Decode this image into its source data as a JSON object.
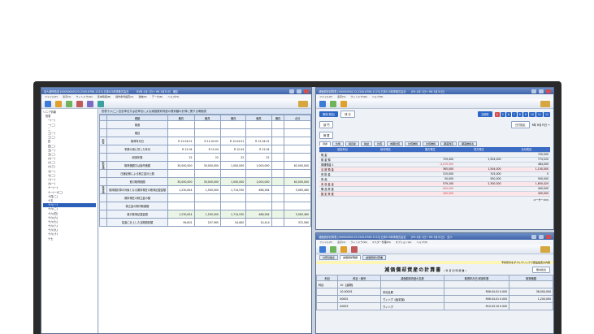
{
  "left_window": {
    "title": "法人税申告書 [00000000123-2345-6789-1123] 日本ICS商事株式会社　　　R5年 4月 1日～ R6 3月31日　確定",
    "menu": [
      "ファイル(F)",
      "表示(V)",
      "ウィンドウ(W)",
      "基本情報(B)",
      "操作条件設定(S)",
      "送信(E)",
      "データ(D)",
      "ヘルプ(H)"
    ],
    "tree": [
      "リニア情報",
      "別表",
      "一(一)",
      "一(二)",
      "二",
      "三(一)",
      "三(二)",
      "四",
      "四(二)",
      "五(一)",
      "五(二)",
      "六(一)",
      "六(二)",
      "六(三)",
      "七(一)",
      "七(二)",
      "八(一)",
      "九(一)",
      "十一(一)",
      "十一(一の二)",
      "十四(二)",
      "十五",
      "十六(一)",
      "十六(二)",
      "十六(四)",
      "十六(六)",
      "十六(七)",
      "十六(八)",
      "十六(九)",
      "十六(十)",
      "十七"
    ],
    "tree_selected_index": 22,
    "form_title": "別表十六(二) 旧定率法又は定率法による減価償却資産の償却額の計算に関する明細書",
    "header_row": [
      "種類",
      "器具",
      "器具",
      "器具",
      "器具",
      "器具",
      "合計"
    ],
    "rows": [
      {
        "side": "",
        "label": "構造",
        "values": [
          "",
          "",
          "",
          "",
          "",
          ""
        ]
      },
      {
        "side": "",
        "label": "細目",
        "values": [
          "",
          "",
          "",
          "",
          "",
          ""
        ]
      },
      {
        "side": "取得",
        "label": "取得年月日",
        "values": [
          "R 12.04.01",
          "R 12.04.01",
          "R 12.04.01",
          "R 12.04.01",
          "",
          ""
        ]
      },
      {
        "side": "",
        "label": "事業の用に供した年月",
        "values": [
          "R 12.04",
          "R 12.04",
          "R 12.04",
          "R 12.04",
          "",
          ""
        ]
      },
      {
        "side": "",
        "label": "耐用年数",
        "values": [
          "22",
          "22",
          "22",
          "22",
          "",
          ""
        ]
      },
      {
        "side": "取得価額",
        "label": "取得価額又は製作価額",
        "values": [
          "30,000,000",
          "30,000,000",
          "1,000,000",
          "1,000,000",
          "",
          "62,000,000"
        ]
      },
      {
        "side": "",
        "label": "圧縮記帳による積立金計上額",
        "values": [
          "",
          "",
          "",
          "",
          "",
          ""
        ]
      },
      {
        "side": "",
        "label": "差引取得価額",
        "values": [
          "30,000,000",
          "30,000,000",
          "1,000,000",
          "1,000,000",
          "",
          "62,000,000"
        ]
      },
      {
        "side": "帳簿価額",
        "label": "償却額計算の対象となる期末現在の帳簿記載金額",
        "values": [
          "1,230,624",
          "1,500,000",
          "1,714,530",
          "468,264",
          "",
          "5,063,460"
        ]
      },
      {
        "side": "",
        "label": "期末現在の積立金の額",
        "values": [
          "",
          "",
          "",
          "",
          "",
          ""
        ]
      },
      {
        "side": "",
        "label": "積立金の期中取崩額",
        "values": [
          "",
          "",
          "",
          "",
          "",
          ""
        ]
      },
      {
        "side": "",
        "label": "差引帳簿記載金額",
        "values": [
          "1,230,624",
          "1,500,000",
          "1,714,530",
          "468,264",
          "",
          "5,063,460"
        ]
      },
      {
        "side": "",
        "label": "損金に計上した当期償却額",
        "values": [
          "99,801",
          "207,565",
          "54,600",
          "10,414",
          "",
          "372,560"
        ]
      }
    ]
  },
  "right_top_window": {
    "title": "減価償却試算表 [00000000123-2345-6789-1123] 日本ICS商事株式会社　　(R5 4月 1日～ R6 3月31日)",
    "menu": [
      "ファイル(F)",
      "表示(V)",
      "ウィンドウ(W)",
      "ヘルプ(H)"
    ],
    "fields": [
      "期首(残高)",
      "残 日",
      "部 門",
      "摘 要"
    ],
    "period_label": "当期末",
    "period_tabs": [
      "4",
      "5",
      "6",
      "7",
      "8",
      "9",
      "10",
      "11",
      "12"
    ],
    "date_label": "日付指定",
    "date_value": "R年 R月 R日 ～",
    "tabs": [
      "資産",
      "負債",
      "純資産",
      "損益",
      "比較",
      "前期比較",
      "比較推移",
      "比較推移",
      "期首残高",
      "期首推移表"
    ],
    "columns": [
      "勘定科目",
      "前月残高",
      "借方発生",
      "貸方発生",
      "当月残高"
    ],
    "rows": [
      {
        "name": "現 金",
        "v": [
          "",
          "",
          "",
          "750,000"
        ],
        "pink": false
      },
      {
        "name": "現 金 預",
        "v": [
          "",
          "729,400",
          "1,504,000",
          "774,520"
        ],
        "pink": false
      },
      {
        "name": "普通預金 1",
        "v": [
          "",
          "-4,019,300",
          "",
          "484,000"
        ],
        "pink": false,
        "red": 1
      },
      {
        "name": "当 座 預 金",
        "v": [
          "",
          "365,000",
          "1,504,000",
          "1,100,000"
        ],
        "pink": true
      },
      {
        "name": "売 掛 金",
        "v": [
          "",
          "315,000",
          "315,000",
          "0"
        ],
        "pink": false
      },
      {
        "name": "商 品",
        "v": [
          "",
          "50,000",
          "550,000",
          "500,000"
        ],
        "pink": false
      },
      {
        "name": "未 収 金 息",
        "v": [
          "",
          "579,100",
          "2,300,000",
          "1,650,420"
        ],
        "pink": true
      },
      {
        "name": "備 品 資 産",
        "v": [
          "",
          "-264,000",
          "",
          "400,000"
        ],
        "pink": false,
        "red": 1
      },
      {
        "name": "固 定 資 産",
        "v": [
          "",
          "400,000",
          "",
          "400,000"
        ],
        "pink": true,
        "red": 1
      }
    ],
    "status": "ユーザー:IICS"
  },
  "right_bottom_window": {
    "title": "減価償却計算表 [00000000123-2345-6789-1123] 日本ICS商事株式会社　　(R5 4月 1日～ R6 3月31日)　法人",
    "menu": [
      "ファイル(F)",
      "表示(V)",
      "ウィンドウ(W)",
      "マスター管理(M)",
      "オプション(O)",
      "ヘルプ(H)"
    ],
    "tabs": [
      "計算基礎表",
      "減価償却明細",
      "減価償却計算書"
    ],
    "hint": "予約形式をダブルクリックで部品設置の内容",
    "doc_title": "減価償却資産の計算書",
    "doc_subtitle": "(科目別明細書)",
    "sort_button": "無効処出",
    "columns": [
      "科目",
      "科目・番号",
      "減価償却資産の名称",
      "取得年月日 耐用年数",
      "取得価額"
    ],
    "rows": [
      {
        "c1": "科目",
        "c2": "10 【建物】",
        "c3": "",
        "c4": "",
        "c5": ""
      },
      {
        "c1": "",
        "c2": "10-00001",
        "c3": "本社社屋",
        "c4": "R06.04.01 0.000",
        "c5": "38,000,000"
      },
      {
        "c1": "",
        "c2": "00002",
        "c3": "ヴィハヴ《後宅場》",
        "c4": "R06.04.01 0.000",
        "c5": "1,200,000"
      },
      {
        "c1": "",
        "c2": "00003",
        "c3": "ヴィハヴ",
        "c4": "R10.03.10 0.000",
        "c5": ""
      }
    ]
  }
}
